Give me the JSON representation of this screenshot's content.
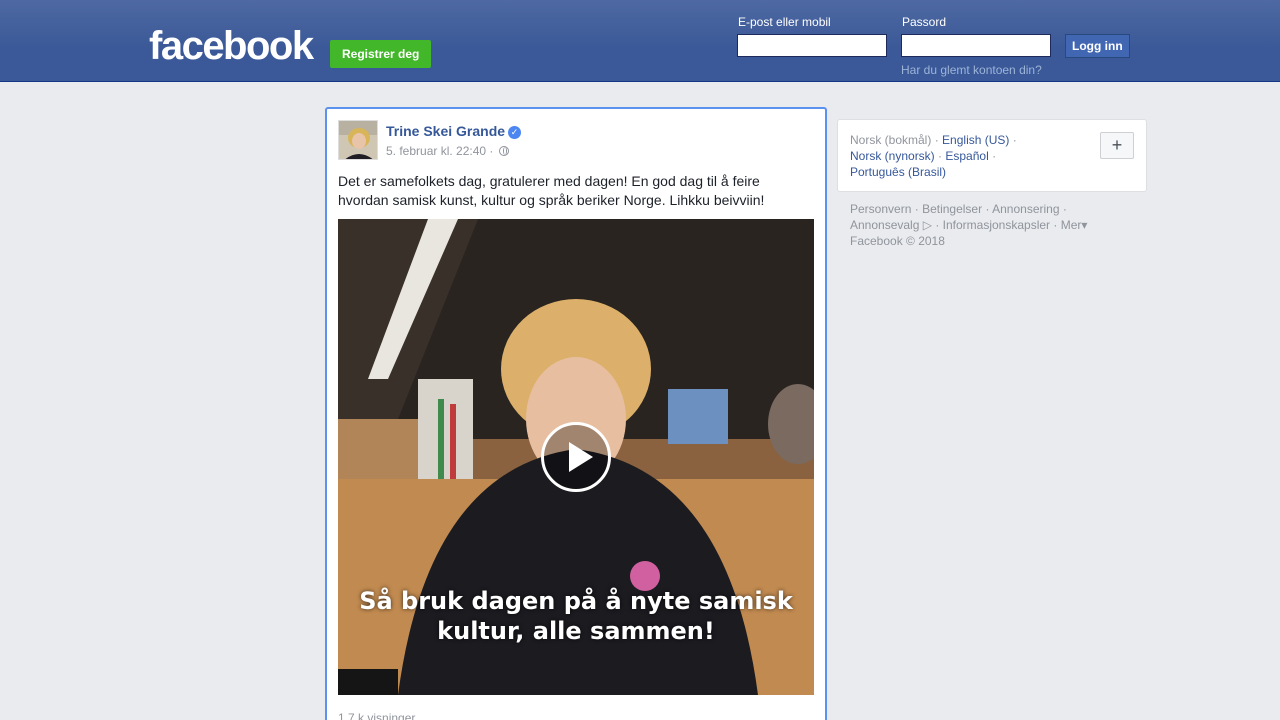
{
  "header": {
    "logo": "facebook",
    "register_label": "Registrer deg",
    "email_label": "E-post eller mobil",
    "password_label": "Passord",
    "login_label": "Logg inn",
    "forgot_label": "Har du glemt kontoen din?",
    "email_value": "",
    "password_value": ""
  },
  "post": {
    "author": "Trine Skei Grande",
    "timestamp": "5. februar kl. 22:40 ·",
    "text": "Det er samefolkets dag, gratulerer med dagen! En god dag til å feire hvordan samisk kunst, kultur og språk beriker Norge. Lihkku beivviin!",
    "video_caption_line1": "Så bruk dagen på å nyte samisk",
    "video_caption_line2": "kultur, alle sammen!",
    "views": "1,7 k visninger"
  },
  "languages": {
    "current": "Norsk (bokmål)",
    "options": [
      "English (US)",
      "Norsk (nynorsk)",
      "Español",
      "Português (Brasil)"
    ],
    "separator": "·",
    "add_label": "+"
  },
  "footer": {
    "links": [
      "Personvern",
      "Betingelser",
      "Annonsering",
      "Annonsevalg",
      "Informasjonskapsler",
      "Mer"
    ],
    "copyright": "Facebook © 2018"
  },
  "colors": {
    "brand_blue": "#3b5998",
    "register_green": "#42b72a",
    "link_blue": "#365899"
  }
}
